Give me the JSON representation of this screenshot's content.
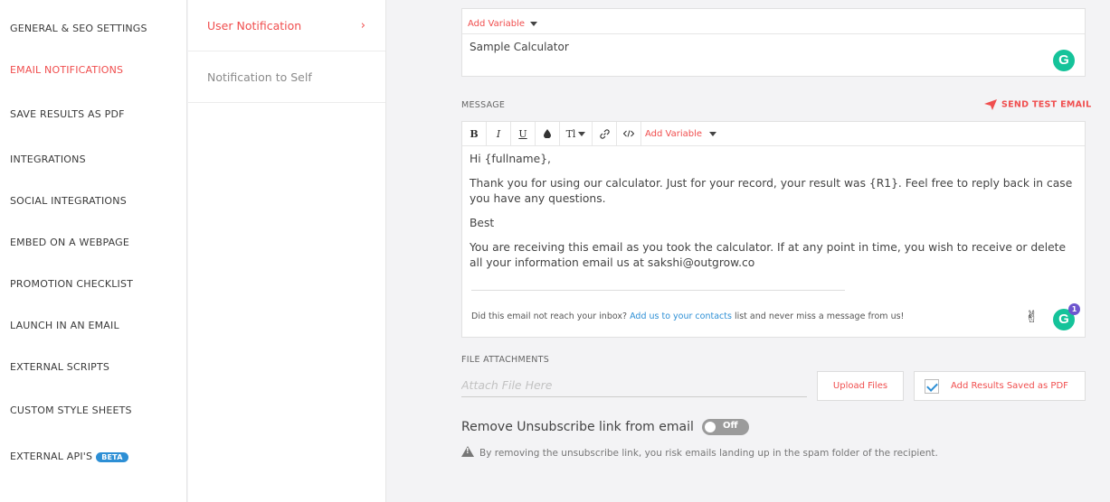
{
  "sidebar": {
    "items": [
      {
        "label": "GENERAL & SEO SETTINGS"
      },
      {
        "label": "EMAIL NOTIFICATIONS"
      },
      {
        "label": "SAVE RESULTS AS PDF"
      },
      {
        "label": "INTEGRATIONS"
      },
      {
        "label": "SOCIAL INTEGRATIONS"
      },
      {
        "label": "EMBED ON A WEBPAGE"
      },
      {
        "label": "PROMOTION CHECKLIST"
      },
      {
        "label": "LAUNCH IN AN EMAIL"
      },
      {
        "label": "EXTERNAL SCRIPTS"
      },
      {
        "label": "CUSTOM STYLE SHEETS"
      },
      {
        "label": "EXTERNAL API'S",
        "badge": "BETA"
      }
    ]
  },
  "subnav": {
    "items": [
      {
        "label": "User Notification",
        "active": true
      },
      {
        "label": "Notification to Self"
      }
    ],
    "chevron": "chevron-right-icon"
  },
  "subject": {
    "add_variable": "Add Variable",
    "value": "Sample Calculator",
    "grammarly_letter": "G"
  },
  "message": {
    "label": "MESSAGE",
    "send_test": "SEND TEST EMAIL",
    "toolbar": {
      "bold": "B",
      "italic": "I",
      "underline": "U",
      "color": "color-drop-icon",
      "text_size": "Tl",
      "link": "link-icon",
      "code": "code-icon",
      "add_variable": "Add Variable"
    },
    "body": {
      "greeting": "Hi {fullname},",
      "para1": "Thank you for using our calculator. Just for your record, your result was {R1}. Feel free to reply back in case you have any questions.",
      "sign": "Best",
      "para2": "You are receiving this email as you took the calculator. If at any point in time, you wish to receive or delete all your information email us at sakshi@outgrow.co"
    },
    "footer": {
      "prefix": "Did this email not reach your inbox?",
      "link": "Add us to your contacts",
      "suffix": "list and never miss a message from us!"
    },
    "grammarly_count": "1"
  },
  "attachments": {
    "label": "FILE ATTACHMENTS",
    "placeholder": "Attach File Here",
    "upload_label": "Upload Files",
    "pdf_label": "Add Results Saved as PDF",
    "pdf_checked": true
  },
  "unsubscribe": {
    "label": "Remove Unsubscribe link from email",
    "toggle_text": "Off",
    "warning": "By removing the unsubscribe link, you risk emails landing up in the spam folder of the recipient."
  },
  "colors": {
    "accent": "#f04e4e",
    "link": "#2d8fd5",
    "grammarly": "#15c39a"
  }
}
